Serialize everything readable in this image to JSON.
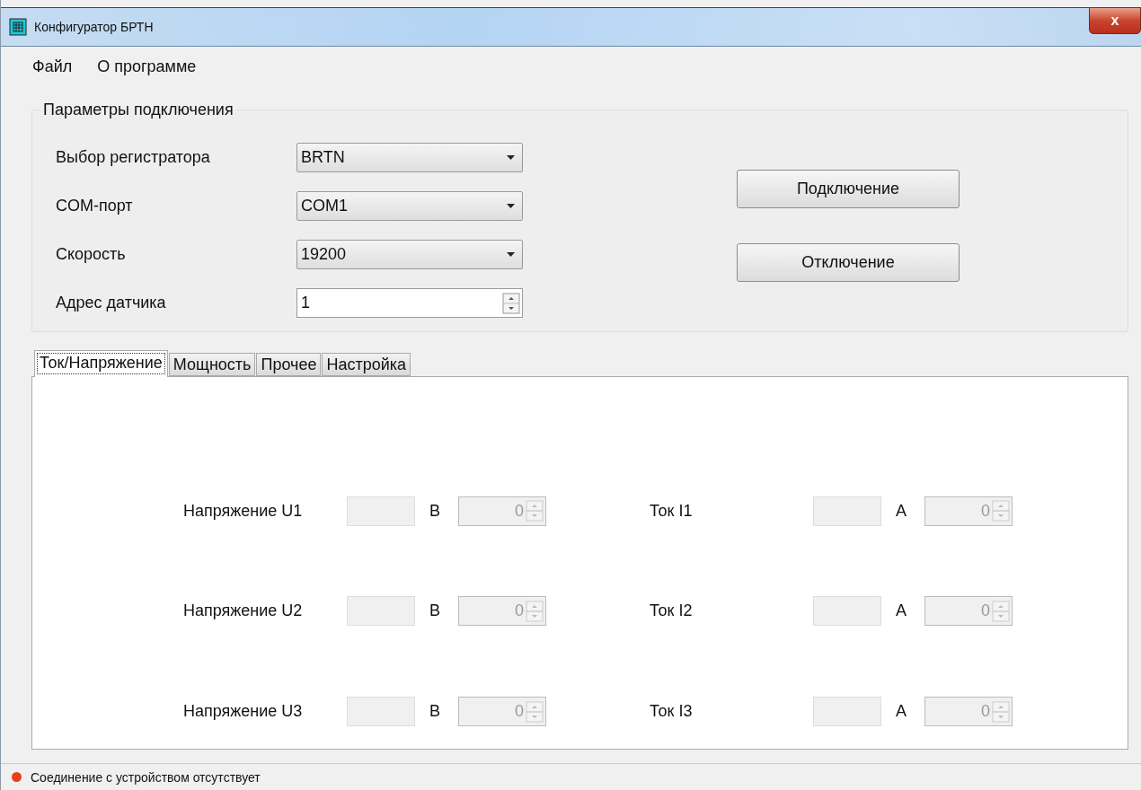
{
  "window": {
    "title": "Конфигуратор БРТН",
    "close": "x"
  },
  "menu": [
    "Файл",
    "О программе"
  ],
  "connection": {
    "title": "Параметры подключения",
    "fields": [
      {
        "kind": "combo",
        "label": "Выбор регистратора",
        "value": "BRTN"
      },
      {
        "kind": "combo",
        "label": "COM-порт",
        "value": "COM1"
      },
      {
        "kind": "combo",
        "label": "Скорость",
        "value": "19200"
      },
      {
        "kind": "spin",
        "label": "Адрес датчика",
        "value": "1"
      }
    ],
    "buttons": [
      "Подключение",
      "Отключение"
    ]
  },
  "tabs": [
    {
      "label": "Ток/Напряжение",
      "selected": true
    },
    {
      "label": "Мощность",
      "selected": false
    },
    {
      "label": "Прочее",
      "selected": false
    },
    {
      "label": "Настройка",
      "selected": false
    }
  ],
  "readings": [
    [
      {
        "label": "Напряжение U1",
        "unit": "В",
        "value": "0",
        "disabled": true
      },
      {
        "label": "Напряжение U2",
        "unit": "В",
        "value": "0",
        "disabled": true
      },
      {
        "label": "Напряжение U3",
        "unit": "В",
        "value": "0",
        "disabled": true
      }
    ],
    [
      {
        "label": "Ток I1",
        "unit": "А",
        "value": "0",
        "disabled": true
      },
      {
        "label": "Ток I2",
        "unit": "А",
        "value": "0",
        "disabled": true
      },
      {
        "label": "Ток I3",
        "unit": "А",
        "value": "0",
        "disabled": true
      }
    ]
  ],
  "status_bar": {
    "text": "Соединение с устройством отсутствует",
    "color": "#e8401c"
  }
}
